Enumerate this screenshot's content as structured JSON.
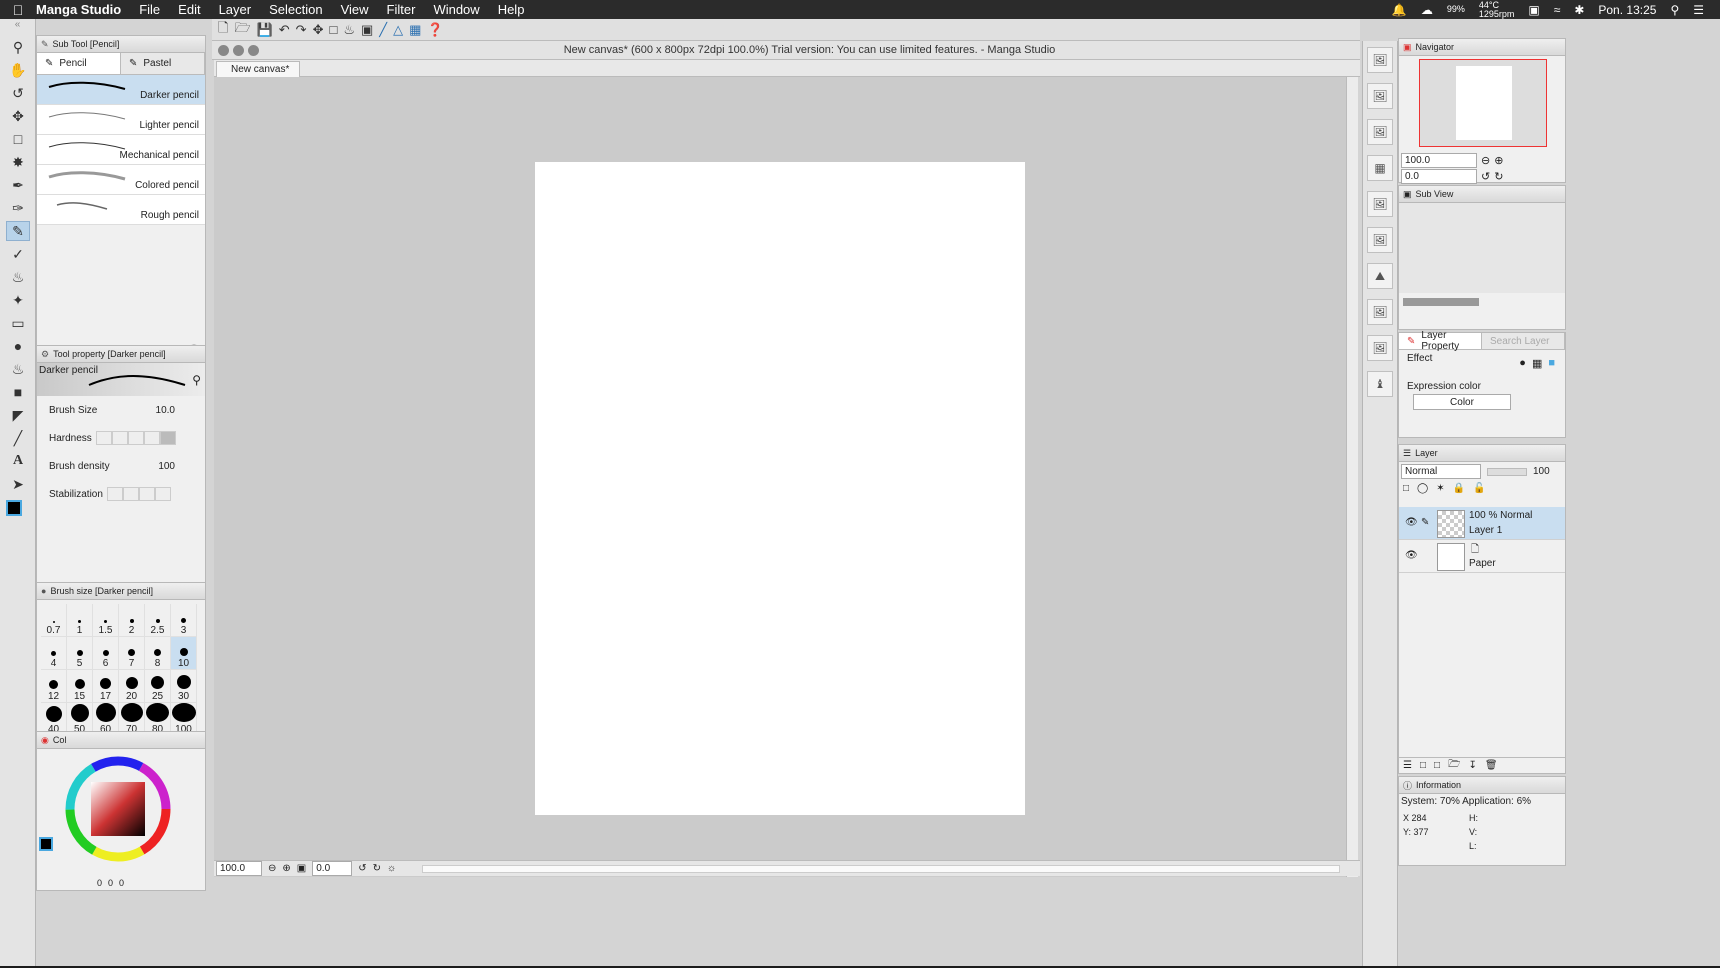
{
  "menubar": {
    "app_name": "Manga Studio",
    "items": [
      "File",
      "Edit",
      "Layer",
      "Selection",
      "View",
      "Filter",
      "Window",
      "Help"
    ],
    "temp": "44°C",
    "rpm": "1295rpm",
    "battery": "99%",
    "clock": "Pon. 13:25"
  },
  "window": {
    "title": "New canvas* (600 x 800px 72dpi 100.0%)  Trial version: You can use limited features. - Manga Studio",
    "doc_tab": "New canvas*"
  },
  "subtool": {
    "header": "Sub Tool [Pencil]",
    "tabs": [
      "Pencil",
      "Pastel"
    ],
    "brushes": [
      "Darker pencil",
      "Lighter pencil",
      "Mechanical pencil",
      "Colored pencil",
      "Rough pencil"
    ]
  },
  "toolprop": {
    "header": "Tool property [Darker pencil]",
    "preview_label": "Darker pencil",
    "brush_size_label": "Brush Size",
    "brush_size_value": "10.0",
    "hardness_label": "Hardness",
    "density_label": "Brush density",
    "density_value": "100",
    "stabilization_label": "Stabilization"
  },
  "brushsize": {
    "header": "Brush size [Darker pencil]",
    "sizes": [
      "0.7",
      "1",
      "1.5",
      "2",
      "2.5",
      "3",
      "4",
      "5",
      "6",
      "7",
      "8",
      "10",
      "12",
      "15",
      "17",
      "20",
      "25",
      "30",
      "40",
      "50",
      "60",
      "70",
      "80",
      "100"
    ]
  },
  "color": {
    "tab_label": "Col",
    "readout_a": "0",
    "readout_b": "0",
    "readout_c": "0"
  },
  "status": {
    "zoom": "100.0",
    "rotation": "0.0"
  },
  "navigator": {
    "title": "Navigator",
    "zoom": "100.0",
    "rotation": "0.0"
  },
  "subview": {
    "title": "Sub View"
  },
  "layerprop": {
    "tab": "Layer Property",
    "tab2": "Search Layer",
    "effect_label": "Effect",
    "expression_label": "Expression color",
    "expression_value": "Color"
  },
  "layers": {
    "title": "Layer",
    "blend": "Normal",
    "opacity": "100",
    "items": [
      {
        "meta": "100 % Normal",
        "name": "Layer 1"
      },
      {
        "meta": "",
        "name": "Paper"
      }
    ]
  },
  "info": {
    "title": "Information",
    "system": "System: 70%  Application:  6%",
    "x": "X  284",
    "y": "Y: 377",
    "h": "H:",
    "v": "V:",
    "l": "L:"
  }
}
